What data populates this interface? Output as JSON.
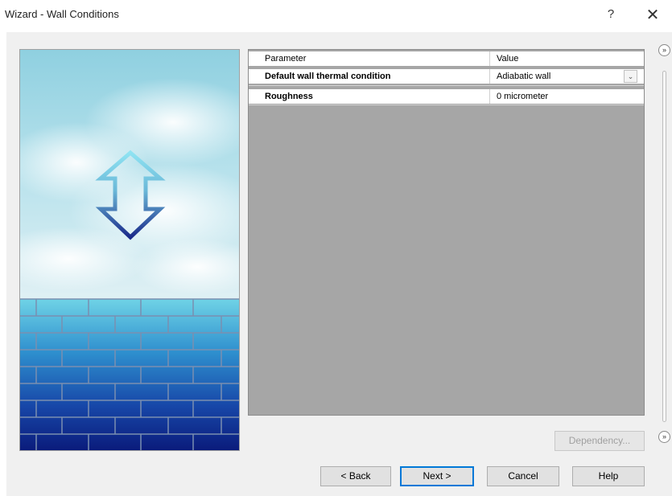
{
  "window": {
    "title": "Wizard - Wall Conditions",
    "help_glyph": "?",
    "close_glyph": "✕"
  },
  "grid": {
    "header": {
      "param": "Parameter",
      "value": "Value"
    },
    "rows": [
      {
        "param": "Default wall thermal condition",
        "value": "Adiabatic wall",
        "has_dropdown": true
      },
      {
        "param": "Roughness",
        "value": "0 micrometer",
        "has_dropdown": false
      }
    ],
    "dropdown_glyph": "⌄"
  },
  "buttons": {
    "dependency": "Dependency...",
    "back": "< Back",
    "next": "Next >",
    "cancel": "Cancel",
    "help": "Help"
  },
  "scroll": {
    "up_glyph": "»",
    "down_glyph": "»"
  },
  "colors": {
    "accent": "#0078d7",
    "grid_background": "#a6a6a6",
    "client_background": "#f0f0f0"
  }
}
